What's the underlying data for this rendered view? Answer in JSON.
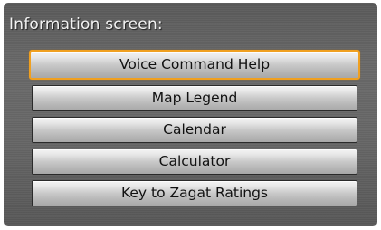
{
  "screen": {
    "title": "Information screen:"
  },
  "menu": {
    "selected_index": 0,
    "items": [
      {
        "label": "Voice Command Help"
      },
      {
        "label": "Map Legend"
      },
      {
        "label": "Calendar"
      },
      {
        "label": "Calculator"
      },
      {
        "label": "Key to Zagat Ratings"
      }
    ]
  },
  "colors": {
    "selection_border": "#f0a020",
    "background": "#636363",
    "title_text": "#f2f2f2"
  }
}
